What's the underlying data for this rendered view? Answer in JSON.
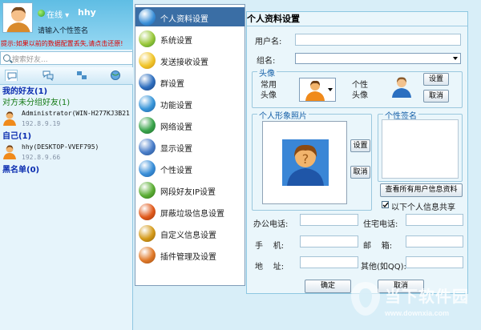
{
  "user": {
    "status": "在线",
    "name": "hhy",
    "signature_placeholder": "请输入个性签名",
    "warning": "提示:如果以前的数据配置丢失,请点击还原!"
  },
  "search": {
    "placeholder": "搜索好友..."
  },
  "groups": {
    "my_friends": "我的好友(1)",
    "ungrouped": "对方未分组好友(1)",
    "self": "自己(1)",
    "blacklist": "黑名单(0)"
  },
  "contacts": [
    {
      "name": "Administrator(WIN-H277KJ3B21",
      "ip": "192.8.9.19"
    },
    {
      "name": "hhy(DESKTOP-VVEF795)",
      "ip": "192.8.9.66"
    }
  ],
  "menu": [
    {
      "label": "个人资料设置",
      "icon": "profile-icon",
      "color": "#3a8fd8"
    },
    {
      "label": "系统设置",
      "icon": "system-icon",
      "color": "#d9a81f"
    },
    {
      "label": "发送接收设置",
      "icon": "send-receive-icon",
      "color": "#e0b82a"
    },
    {
      "label": "群设置",
      "icon": "group-icon",
      "color": "#2f6fbf"
    },
    {
      "label": "功能设置",
      "icon": "function-icon",
      "color": "#3996d9"
    },
    {
      "label": "网络设置",
      "icon": "network-icon",
      "color": "#3aa44c"
    },
    {
      "label": "显示设置",
      "icon": "display-icon",
      "color": "#4a7ec9"
    },
    {
      "label": "个性设置",
      "icon": "personal-icon",
      "color": "#3a8fd8"
    },
    {
      "label": "网段好友IP设置",
      "icon": "ip-icon",
      "color": "#5cae35"
    },
    {
      "label": "屏蔽垃圾信息设置",
      "icon": "block-icon",
      "color": "#e05a1c"
    },
    {
      "label": "自定义信息设置",
      "icon": "custom-icon",
      "color": "#d49a1a"
    },
    {
      "label": "插件管理及设置",
      "icon": "plugin-icon",
      "color": "#e07a2a"
    }
  ],
  "panel": {
    "title": "个人资料设置",
    "username_label": "用户名:",
    "group_label": "组名:",
    "avatar_legend": "头像",
    "common_avatar": "常用\n头像",
    "custom_avatar": "个性\n头像",
    "set_label": "设置",
    "cancel_label": "取消",
    "photo_legend": "个人形象照片",
    "signature_legend": "个性签名",
    "view_all": "查看所有用户信息资料",
    "share_label": "以下个人信息共享",
    "office_phone": "办公电话:",
    "home_phone": "住宅电话:",
    "mobile": "手    机:",
    "email": "邮    箱:",
    "address": "地    址:",
    "other": "其他(如QQ):",
    "ok": "确定",
    "cancel": "取消"
  },
  "watermark": {
    "text": "当下软件园",
    "url": "www.downxia.com"
  }
}
